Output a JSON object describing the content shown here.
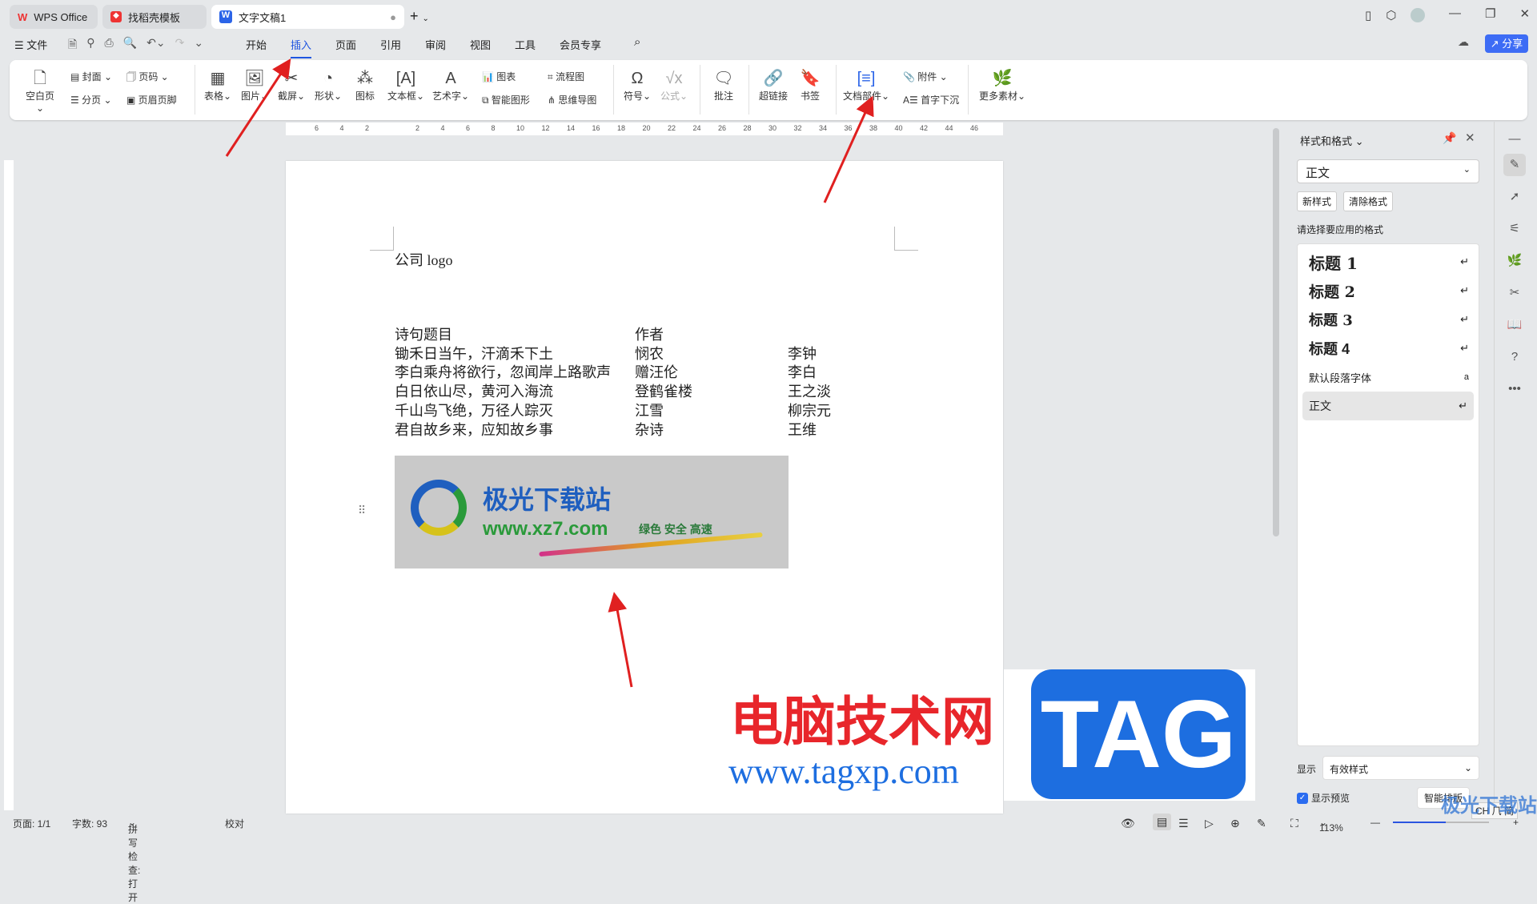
{
  "tabs": [
    {
      "label": "WPS Office"
    },
    {
      "label": "找稻壳模板"
    },
    {
      "label": "文字文稿1"
    }
  ],
  "menu": {
    "file": "文件",
    "items": [
      "开始",
      "插入",
      "页面",
      "引用",
      "审阅",
      "视图",
      "工具",
      "会员专享"
    ],
    "active": "插入",
    "share": "分享"
  },
  "ribbon": {
    "big": [
      {
        "label": "空白页"
      },
      {
        "label": "表格"
      },
      {
        "label": "图片"
      },
      {
        "label": "截屏"
      },
      {
        "label": "形状"
      },
      {
        "label": "图标"
      },
      {
        "label": "文本框"
      },
      {
        "label": "艺术字"
      },
      {
        "label": "符号"
      },
      {
        "label": "公式"
      },
      {
        "label": "批注"
      },
      {
        "label": "超链接"
      },
      {
        "label": "书签"
      },
      {
        "label": "文档部件"
      },
      {
        "label": "更多素材"
      }
    ],
    "small": [
      {
        "label": "封面"
      },
      {
        "label": "分页"
      },
      {
        "label": "页码"
      },
      {
        "label": "页眉页脚"
      },
      {
        "label": "图表"
      },
      {
        "label": "智能图形"
      },
      {
        "label": "流程图"
      },
      {
        "label": "思维导图"
      },
      {
        "label": "附件"
      },
      {
        "label": "首字下沉"
      }
    ]
  },
  "ruler": [
    "6",
    "4",
    "2",
    "",
    "2",
    "4",
    "6",
    "8",
    "10",
    "12",
    "14",
    "16",
    "18",
    "20",
    "22",
    "24",
    "26",
    "28",
    "30",
    "32",
    "34",
    "36",
    "38",
    "40",
    "42",
    "44",
    "46"
  ],
  "document": {
    "header": "公司 logo",
    "table": [
      [
        "诗句题目",
        "作者",
        ""
      ],
      [
        "锄禾日当午，汗滴禾下土",
        "悯农",
        "李钟"
      ],
      [
        "李白乘舟将欲行，忽闻岸上路歌声",
        "赠汪伦",
        "李白"
      ],
      [
        "白日依山尽，黄河入海流",
        "登鹤雀楼",
        "王之淡"
      ],
      [
        "千山鸟飞绝，万径人踪灭",
        "江雪",
        "柳宗元"
      ],
      [
        "君自故乡来，应知故乡事",
        "杂诗",
        "王维"
      ]
    ],
    "image": {
      "title": "极光下载站",
      "url": "www.xz7.com",
      "slogan": "绿色 安全 高速"
    }
  },
  "panel": {
    "title": "样式和格式",
    "current": "正文",
    "new_style": "新样式",
    "clear_format": "清除格式",
    "prompt": "请选择要应用的格式",
    "styles": [
      {
        "label": "标题 1"
      },
      {
        "label": "标题 2"
      },
      {
        "label": "标题 3"
      },
      {
        "label": "标题 4"
      },
      {
        "label": "默认段落字体"
      },
      {
        "label": "正文"
      }
    ],
    "show_label": "显示",
    "show_value": "有效样式",
    "preview_label": "显示预览",
    "preview_checked": true,
    "smart": "智能排版"
  },
  "status": {
    "page": "页面: 1/1",
    "words": "字数: 93",
    "spell": "拼写检查: 打开",
    "proof": "校对",
    "zoom": "113%",
    "zoom_fraction": 0.55,
    "ime": "CH ⺇ 简"
  },
  "watermark": {
    "site": "电脑技术网",
    "url": "www.tagxp.com",
    "tag": "TAG",
    "corner": "极光下载站"
  },
  "colors": {
    "accent": "#1f55e0",
    "share": "#3d6cf5",
    "arrow": "#e02020"
  }
}
